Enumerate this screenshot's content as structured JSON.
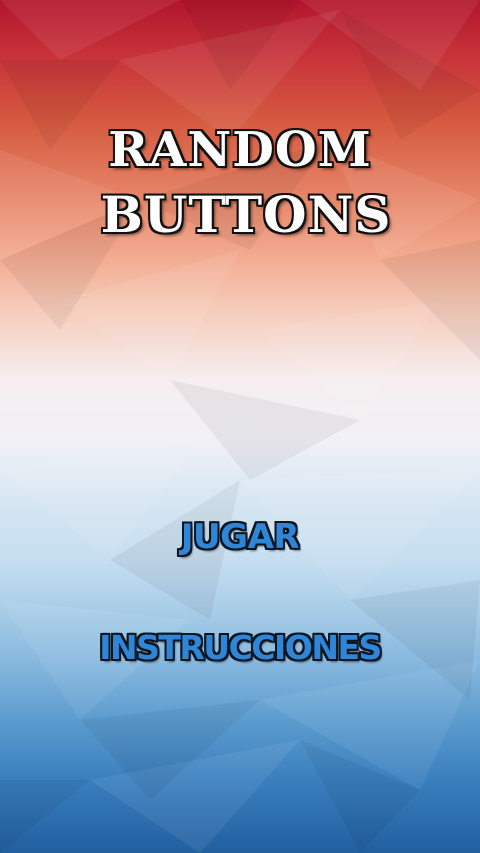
{
  "title": {
    "line1": "RANDOM",
    "line2": "BUTTONS"
  },
  "menu": {
    "play_label": "JUGAR",
    "instructions_label": "INSTRUCCIONES"
  },
  "colors": {
    "button_text": "#2f86d6",
    "button_outline": "#0c1622",
    "title_text": "#ffffff"
  }
}
